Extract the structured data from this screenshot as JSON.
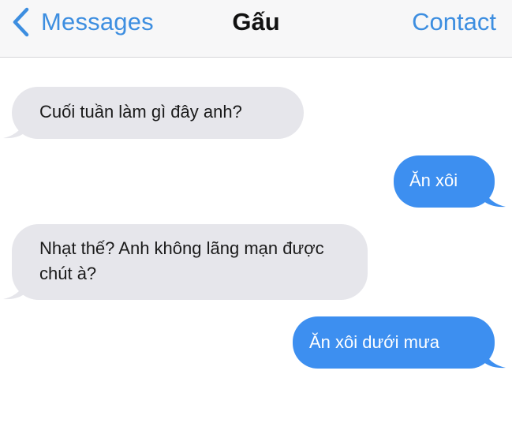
{
  "nav": {
    "back_label": "Messages",
    "title": "Gấu",
    "contact_label": "Contact"
  },
  "colors": {
    "accent": "#3d8ee0",
    "outgoing_bubble": "#3d8ff0",
    "incoming_bubble": "#e6e6eb",
    "navbar_bg": "#f7f7f8"
  },
  "icons": {
    "back": "chevron-left-icon"
  },
  "messages": [
    {
      "direction": "incoming",
      "text": "Cuối tuần làm gì đây anh?"
    },
    {
      "direction": "outgoing",
      "text": "Ăn xôi"
    },
    {
      "direction": "incoming",
      "text": "Nhạt thế? Anh không lãng mạn được chút à?"
    },
    {
      "direction": "outgoing",
      "text": "Ăn xôi dưới mưa"
    }
  ]
}
